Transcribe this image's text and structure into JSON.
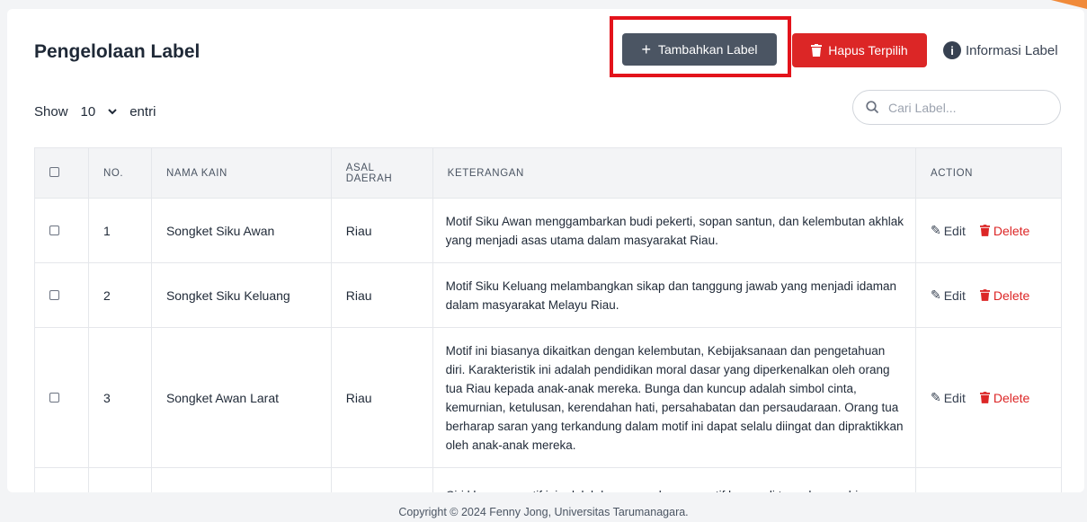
{
  "header": {
    "title": "Pengelolaan Label",
    "add_button": "Tambahkan Label",
    "delete_selected_button": "Hapus Terpilih",
    "info_label": "Informasi Label"
  },
  "controls": {
    "show_label": "Show",
    "entries_value": "10",
    "entries_suffix": "entri",
    "search_placeholder": "Cari Label..."
  },
  "table": {
    "columns": [
      "NO.",
      "NAMA KAIN",
      "ASAL DAERAH",
      "KETERANGAN",
      "ACTION"
    ],
    "edit_label": "Edit",
    "delete_label": "Delete",
    "rows": [
      {
        "no": "1",
        "name": "Songket Siku Awan",
        "origin": "Riau",
        "desc": "Motif Siku Awan menggambarkan budi pekerti, sopan santun, dan kelembutan akhlak yang menjadi asas utama dalam masyarakat Riau."
      },
      {
        "no": "2",
        "name": "Songket Siku Keluang",
        "origin": "Riau",
        "desc": "Motif Siku Keluang melambangkan sikap dan tanggung jawab yang menjadi idaman dalam masyarakat Melayu Riau."
      },
      {
        "no": "3",
        "name": "Songket Awan Larat",
        "origin": "Riau",
        "desc": "Motif ini biasanya dikaitkan dengan kelembutan, Kebijaksanaan dan pengetahuan diri. Karakteristik ini adalah pendidikan moral dasar yang diperkenalkan oleh orang tua Riau kepada anak-anak mereka. Bunga dan kuncup adalah simbol cinta, kemurnian, ketulusan, kerendahan hati, persahabatan dan persaudaraan. Orang tua berharap saran yang terkandung dalam motif ini dapat selalu diingat dan dipraktikkan oleh anak-anak mereka."
      },
      {
        "no": "",
        "name": "",
        "origin": "",
        "desc": "Ciri khasnya motif ini adalah kurungan dengan motif bunga di tengah yang bisa"
      }
    ]
  },
  "footer": {
    "copyright": "Copyright © 2024 Fenny Jong, Universitas Tarumanagara."
  },
  "colors": {
    "add_button": "#4b5563",
    "delete_button": "#dc2626",
    "highlight_box": "#e3131b",
    "corner_accent": "#f08a3a"
  }
}
